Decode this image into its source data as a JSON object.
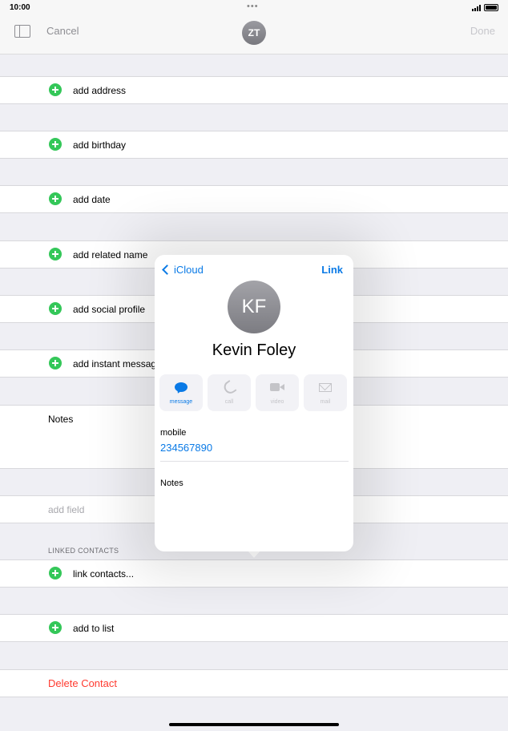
{
  "status": {
    "time": "10:00"
  },
  "nav": {
    "cancel": "Cancel",
    "avatar_initials": "ZT",
    "done": "Done"
  },
  "rows": {
    "add_address": "add address",
    "add_birthday": "add birthday",
    "add_date": "add date",
    "add_related_name": "add related name",
    "add_social_profile": "add social profile",
    "add_instant_message": "add instant message",
    "notes": "Notes",
    "add_field": "add field",
    "linked_contacts_header": "LINKED CONTACTS",
    "link_contacts": "link contacts...",
    "add_to_list": "add to list",
    "delete_contact": "Delete Contact"
  },
  "popover": {
    "back_label": "iCloud",
    "link_label": "Link",
    "avatar_initials": "KF",
    "name": "Kevin Foley",
    "actions": [
      "message",
      "call",
      "video",
      "mail"
    ],
    "field_label": "mobile",
    "phone": "234567890",
    "notes_label": "Notes"
  },
  "colors": {
    "accent": "#0a7ae6",
    "green": "#34c759",
    "destructive": "#ff3b30"
  }
}
